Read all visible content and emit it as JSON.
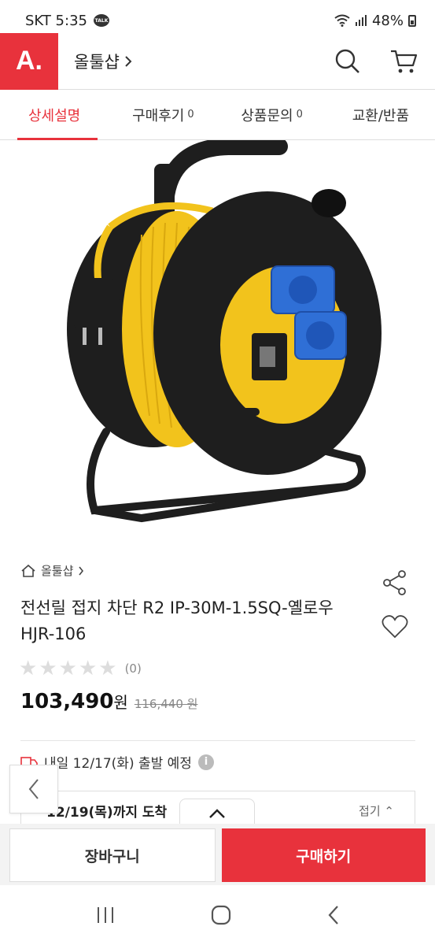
{
  "status_bar": {
    "carrier_time": "SKT 5:35",
    "talk_badge": "TALK",
    "battery": "48%"
  },
  "header": {
    "logo": "A.",
    "shop_name": "올툴샵",
    "icons": [
      "search-icon",
      "cart-icon"
    ]
  },
  "tabs": [
    {
      "label": "상세설명",
      "count": "",
      "active": true
    },
    {
      "label": "구매후기",
      "count": "0",
      "active": false
    },
    {
      "label": "상품문의",
      "count": "0",
      "active": false
    },
    {
      "label": "교환/반품",
      "count": "",
      "active": false
    }
  ],
  "product": {
    "breadcrumb": "올툴샵",
    "title": "전선릴 접지 차단 R2 IP-30M-1.5SQ-옐로우 HJR-106",
    "rating_count": "(0)",
    "rating_value": 0,
    "price": "103,490",
    "price_unit": "원",
    "original_price": "116,440 원",
    "shipping": "내일 12/17(화) 출발 예정",
    "delivery": "12/19(목)까지 도착",
    "fold_label": "접기"
  },
  "actions": {
    "cart": "장바구니",
    "buy": "구매하기"
  },
  "colors": {
    "brand_red": "#e8323c",
    "reel_yellow": "#f2c31c",
    "reel_black": "#1e1e1e",
    "socket_blue": "#2f6fd6"
  }
}
